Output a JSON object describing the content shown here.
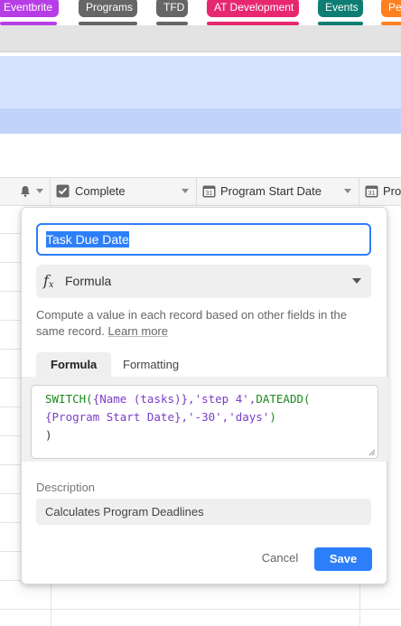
{
  "tags": [
    {
      "label": "Eventbrite",
      "color": "#b73ee6"
    },
    {
      "label": "Programs",
      "color": "#666666"
    },
    {
      "label": "TFD",
      "color": "#666666"
    },
    {
      "label": "AT Development",
      "color": "#e7286f"
    },
    {
      "label": "Events",
      "color": "#0e7d73"
    },
    {
      "label": "Per",
      "color": "#ff8020"
    }
  ],
  "columns": {
    "complete": "Complete",
    "program_start_date": "Program Start Date",
    "partial": "Pro"
  },
  "modal": {
    "field_name": "Task Due Date",
    "field_type": "Formula",
    "type_description": "Compute a value in each record based on other fields in the same record.",
    "learn_more": "Learn more",
    "tabs": [
      "Formula",
      "Formatting"
    ],
    "active_tab": "Formula",
    "formula": {
      "line1_fn": "SWITCH(",
      "line1_field": "{Name (tasks)}",
      "line1_str": ",'step 4',",
      "line1_fn2": "DATEADD(",
      "line2_field": "{Program Start Date}",
      "line2_str": ",'-30','days'",
      "line2_close": ")",
      "line3": ")"
    },
    "description_label": "Description",
    "description_value": "Calculates Program Deadlines",
    "cancel_label": "Cancel",
    "save_label": "Save"
  },
  "colors": {
    "accent": "#2d7ff9",
    "banner": "#d4e2fd"
  }
}
